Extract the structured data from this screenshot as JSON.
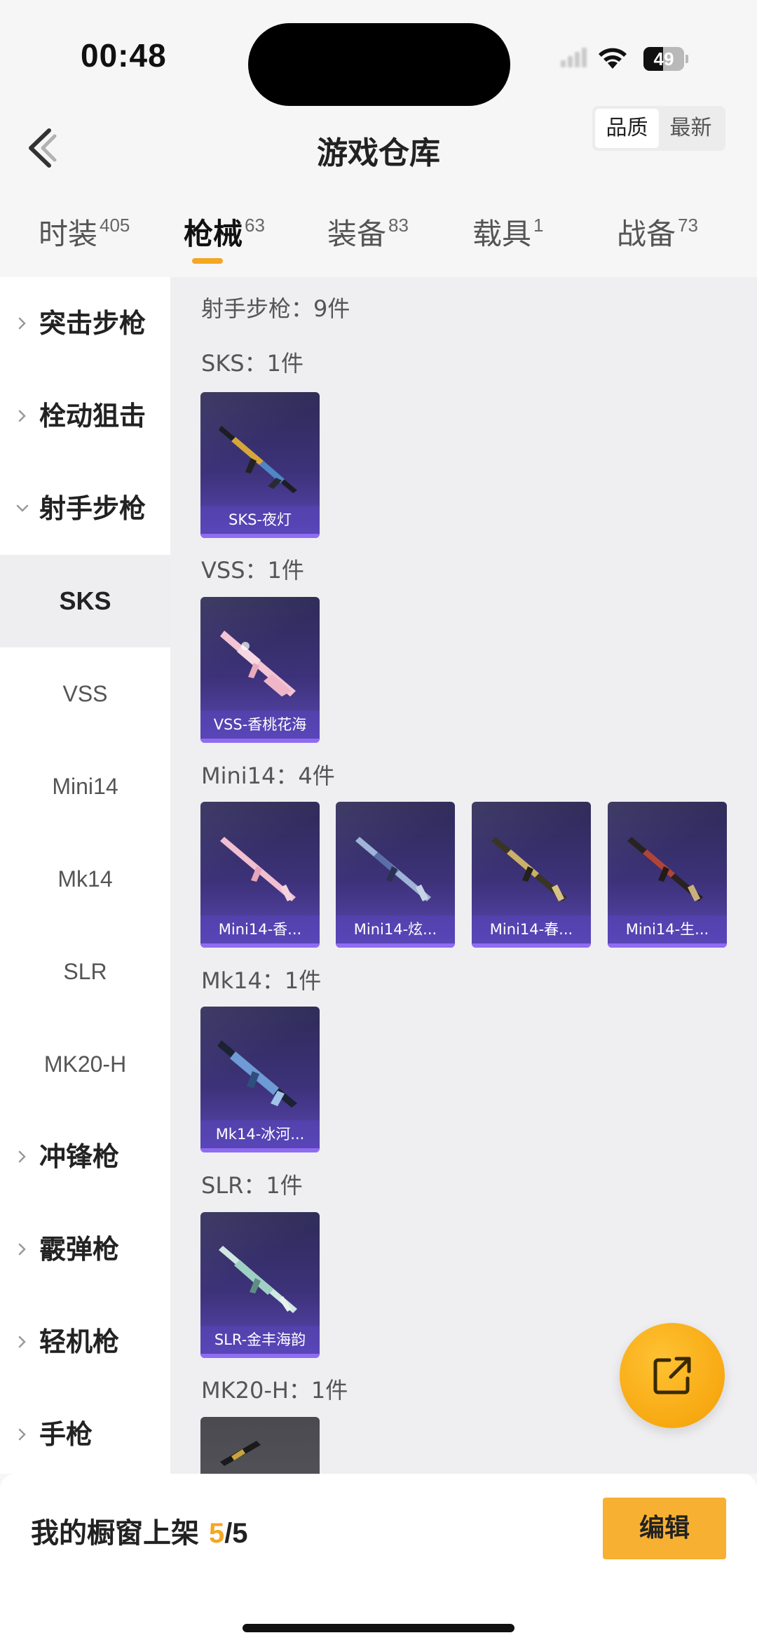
{
  "status": {
    "time": "00:48",
    "battery": "49",
    "battery_level": 0.49
  },
  "header": {
    "title": "游戏仓库",
    "sort_quality": "品质",
    "sort_newest": "最新"
  },
  "tabs": [
    {
      "label": "时装",
      "count": "405"
    },
    {
      "label": "枪械",
      "count": "63"
    },
    {
      "label": "装备",
      "count": "83"
    },
    {
      "label": "载具",
      "count": "1"
    },
    {
      "label": "战备",
      "count": "73"
    }
  ],
  "sidebar": {
    "items": [
      {
        "label": "突击步枪"
      },
      {
        "label": "栓动狙击"
      },
      {
        "label": "射手步枪"
      },
      {
        "label": "SKS"
      },
      {
        "label": "VSS"
      },
      {
        "label": "Mini14"
      },
      {
        "label": "Mk14"
      },
      {
        "label": "SLR"
      },
      {
        "label": "MK20-H"
      },
      {
        "label": "冲锋枪"
      },
      {
        "label": "霰弹枪"
      },
      {
        "label": "轻机枪"
      },
      {
        "label": "手枪"
      }
    ]
  },
  "content": {
    "section_title": "射手步枪：9件",
    "groups": [
      {
        "title": "SKS：1件",
        "items": [
          "SKS-夜灯"
        ]
      },
      {
        "title": "VSS：1件",
        "items": [
          "VSS-香桃花海"
        ]
      },
      {
        "title": "Mini14：4件",
        "items": [
          "Mini14-香...",
          "Mini14-炫...",
          "Mini14-春...",
          "Mini14-生..."
        ]
      },
      {
        "title": "Mk14：1件",
        "items": [
          "Mk14-冰河..."
        ]
      },
      {
        "title": "SLR：1件",
        "items": [
          "SLR-金丰海韵"
        ]
      },
      {
        "title": "MK20-H：1件",
        "items": []
      }
    ]
  },
  "bottom": {
    "shelf_label": "我的橱窗上架 ",
    "shelf_count": "5",
    "shelf_total": "/5",
    "edit_label": "编辑"
  },
  "colors": {
    "accent": "#f5a623",
    "card_purple": "#3d327a"
  }
}
